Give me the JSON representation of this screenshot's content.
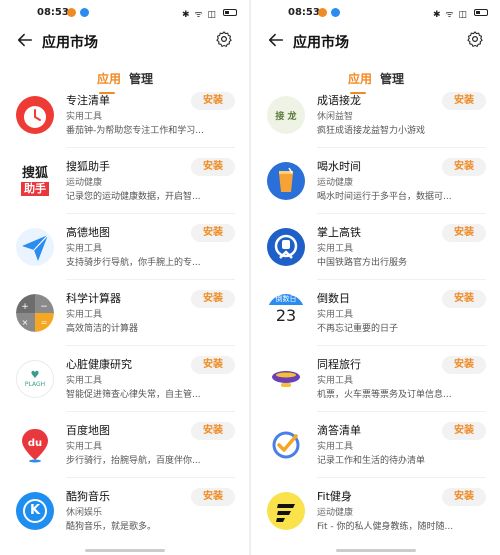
{
  "status": {
    "time": "08:53",
    "system": "✱ ᯤ ◫"
  },
  "header": {
    "title": "应用市场"
  },
  "tabs": {
    "apps": "应用",
    "manage": "管理"
  },
  "install_label": "安装",
  "left_apps": [
    {
      "name": "专注清单",
      "category": "实用工具",
      "desc": "番茄钟-为帮助您专注工作和学习...",
      "icon": "tomato-clock-icon"
    },
    {
      "name": "搜狐助手",
      "category": "运动健康",
      "desc": "记录您的运动健康数据，开启智...",
      "icon": "sohu-logo-icon",
      "icon_text_top": "搜狐",
      "icon_text_bottom": "助手"
    },
    {
      "name": "高德地图",
      "category": "实用工具",
      "desc": "支持骑步行导航，你手腕上的专...",
      "icon": "paper-plane-icon"
    },
    {
      "name": "科学计算器",
      "category": "实用工具",
      "desc": "高效简洁的计算器",
      "icon": "calculator-icon"
    },
    {
      "name": "心脏健康研究",
      "category": "实用工具",
      "desc": "智能促进筛查心律失常，自主管...",
      "icon": "heart-health-icon",
      "icon_text": "PLAGH"
    },
    {
      "name": "百度地图",
      "category": "实用工具",
      "desc": "步行骑行，抬腕导航，百度伴你...",
      "icon": "baidu-map-pin-icon",
      "icon_text": "du"
    },
    {
      "name": "酷狗音乐",
      "category": "休闲娱乐",
      "desc": "酷狗音乐，就是歌多。",
      "icon": "kugou-music-icon",
      "icon_text": "K"
    }
  ],
  "right_apps": [
    {
      "name": "成语接龙",
      "category": "休闲益智",
      "desc": "疯狂成语接龙益智力小游戏",
      "icon": "idiom-chain-icon",
      "icon_text": "接 龙"
    },
    {
      "name": "喝水时间",
      "category": "运动健康",
      "desc": "喝水时间运行于多平台，数据可...",
      "icon": "water-cup-icon"
    },
    {
      "name": "掌上高铁",
      "category": "实用工具",
      "desc": "中国铁路官方出行服务",
      "icon": "railway-logo-icon"
    },
    {
      "name": "倒数日",
      "category": "实用工具",
      "desc": "不再忘记重要的日子",
      "icon": "calendar-icon",
      "icon_text_top": "倒数日",
      "icon_text_bottom": "23"
    },
    {
      "name": "同程旅行",
      "category": "实用工具",
      "desc": "机票，火车票等票务及订单信息...",
      "icon": "airship-icon"
    },
    {
      "name": "滴答清单",
      "category": "实用工具",
      "desc": "记录工作和生活的待办清单",
      "icon": "checkmark-icon"
    },
    {
      "name": "Fit健身",
      "category": "运动健康",
      "desc": "Fit - 你的私人健身教练，随时随...",
      "icon": "fit-logo-icon"
    }
  ]
}
